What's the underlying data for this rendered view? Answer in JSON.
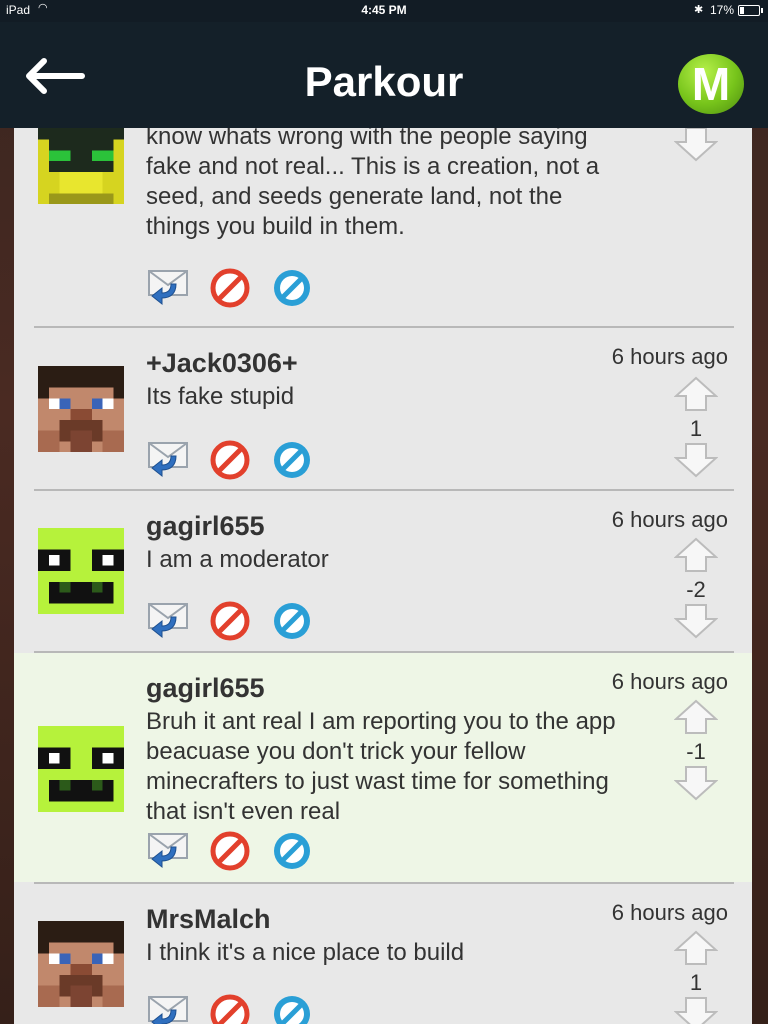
{
  "status_bar": {
    "carrier": "iPad",
    "time": "4:45 PM",
    "battery": "17%"
  },
  "nav": {
    "title": "Parkour",
    "logo_letter": "M"
  },
  "colors": {
    "nav_bg": "#142029",
    "list_bg": "#e8e8e8",
    "highlight_bg": "#eef6e6",
    "logo_green": "#77c41b"
  },
  "comments": [
    {
      "username": "",
      "avatar": "yellow-mob-avatar",
      "body": "know whats wrong with the people saying fake and not real... This is a creation, not a seed, and seeds generate land, not the things you build in them.",
      "time": "",
      "score": ""
    },
    {
      "username": "+Jack0306+",
      "avatar": "steve-avatar",
      "body": "Its fake stupid",
      "time": "6 hours ago",
      "score": "1"
    },
    {
      "username": "gagirl655",
      "avatar": "green-mob-avatar",
      "body": "I am a moderator",
      "time": "6 hours ago",
      "score": "-2"
    },
    {
      "username": "gagirl655",
      "avatar": "green-mob-avatar",
      "body": "Bruh it ant real I am reporting you to the app beacuase you don't trick your fellow minecrafters to just wast time for something that isn't even real",
      "time": "6 hours ago",
      "score": "-1"
    },
    {
      "username": "MrsMalch",
      "avatar": "steve-avatar",
      "body": "I think it's a nice place to build",
      "time": "6 hours ago",
      "score": "1"
    }
  ]
}
